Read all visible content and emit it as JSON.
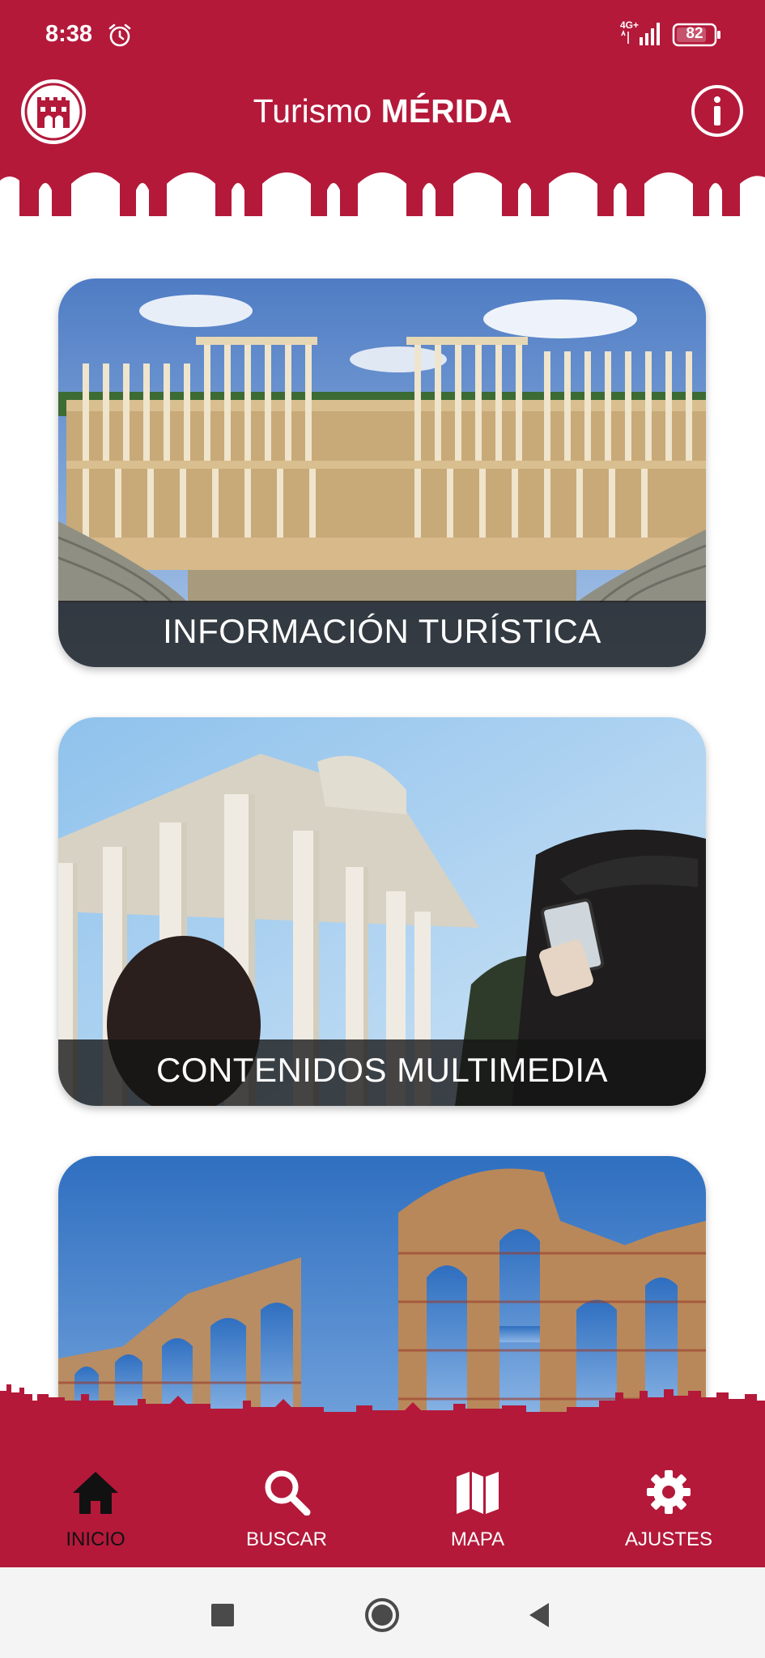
{
  "status_bar": {
    "time": "8:38",
    "network": "4G+",
    "battery": "82"
  },
  "header": {
    "title_prefix": "Turismo ",
    "title_brand": "MÉRIDA"
  },
  "cards": [
    {
      "label": "INFORMACIÓN TURÍSTICA"
    },
    {
      "label": "CONTENIDOS MULTIMEDIA"
    },
    {
      "label": ""
    }
  ],
  "bottom_nav": [
    {
      "label": "INICIO",
      "icon": "home-icon",
      "active": true
    },
    {
      "label": "BUSCAR",
      "icon": "search-icon",
      "active": false
    },
    {
      "label": "MAPA",
      "icon": "map-icon",
      "active": false
    },
    {
      "label": "AJUSTES",
      "icon": "gear-icon",
      "active": false
    }
  ],
  "colors": {
    "brand": "#b4193a",
    "band": "#141414",
    "active_nav": "#111111"
  }
}
